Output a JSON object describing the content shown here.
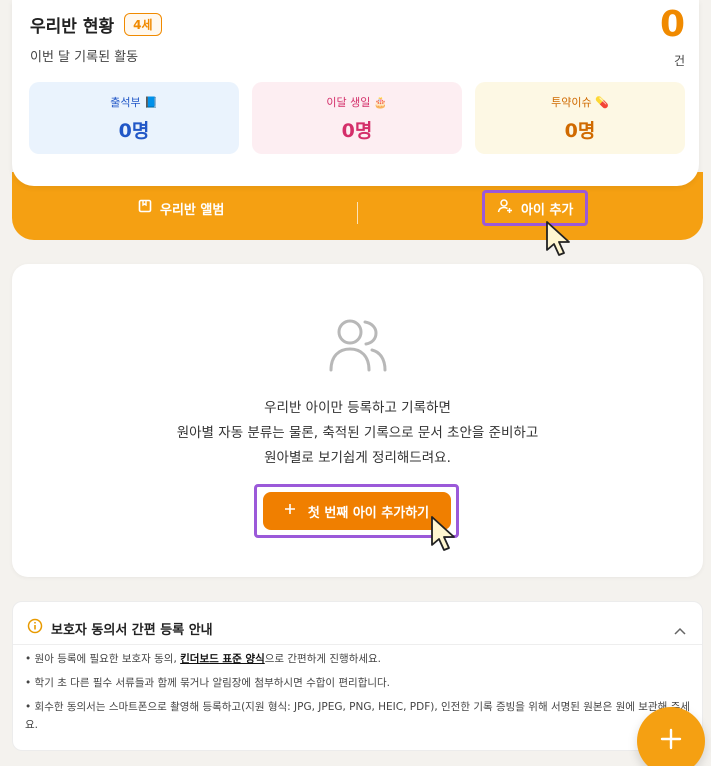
{
  "status": {
    "title": "우리반 현황",
    "age_badge": "4세",
    "subtitle": "이번 달 기록된 활동",
    "count": "0",
    "count_unit": "건",
    "stats": [
      {
        "label": "출석부 📘",
        "value": "0명"
      },
      {
        "label": "이달 생일 🎂",
        "value": "0명"
      },
      {
        "label": "투약이슈 💊",
        "value": "0명"
      }
    ]
  },
  "actions": {
    "album_label": "우리반 앨범",
    "add_child_label": "아이 추가"
  },
  "empty": {
    "lines": [
      "우리반 아이만 등록하고 기록하면",
      "원아별 자동 분류는 물론, 축적된 기록으로 문서 초안을 준비하고",
      "원아별로 보기쉽게 정리해드려요."
    ],
    "button_label": "첫 번째 아이 추가하기"
  },
  "guide": {
    "title": "보호자 동의서 간편 등록 안내",
    "item1_pre": "• 원아 등록에 필요한 보호자 동의, ",
    "item1_emph": "킨더보드 표준 양식",
    "item1_post": "으로 간편하게 진행하세요.",
    "item2": "• 학기 초 다른 필수 서류들과 함께 묶거나 알림장에 첨부하시면 수합이 편리합니다.",
    "item3": "• 회수한 동의서는 스마트폰으로 촬영해 등록하고(지원 형식: JPG, JPEG, PNG, HEIC, PDF), 인전한 기록 증빙을 위해 서명된 원본은 원에 보관해 주세요."
  },
  "colors": {
    "accent": "#f5a012",
    "primary": "#f07f00",
    "highlight": "#9b59d9"
  },
  "icons": [
    "album-icon",
    "user-add-icon",
    "people-icon",
    "plus-icon",
    "info-icon",
    "chevron-up-icon",
    "cursor-icon"
  ]
}
